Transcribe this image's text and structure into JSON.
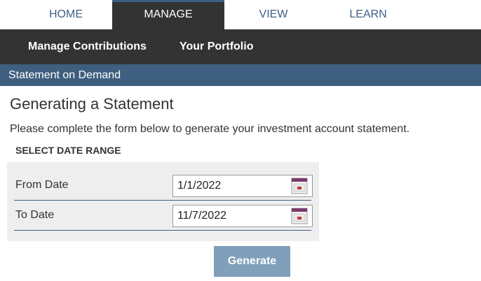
{
  "top_tabs": [
    {
      "label": "HOME"
    },
    {
      "label": "MANAGE"
    },
    {
      "label": "VIEW"
    },
    {
      "label": "LEARN"
    }
  ],
  "sub_nav": [
    {
      "label": "Manage Contributions"
    },
    {
      "label": "Your Portfolio"
    }
  ],
  "breadcrumb": "Statement on Demand",
  "page": {
    "title": "Generating a Statement",
    "description": "Please complete the form below to generate your investment account statement.",
    "section_label": "SELECT DATE RANGE"
  },
  "form": {
    "from": {
      "label": "From Date",
      "value": "1/1/2022",
      "icon": "calendar-icon"
    },
    "to": {
      "label": "To Date",
      "value": "11/7/2022",
      "icon": "calendar-icon"
    }
  },
  "generate_label": "Generate",
  "colors": {
    "accent": "#3e5f86",
    "nav_dark": "#333333",
    "button": "#7f9fba"
  }
}
